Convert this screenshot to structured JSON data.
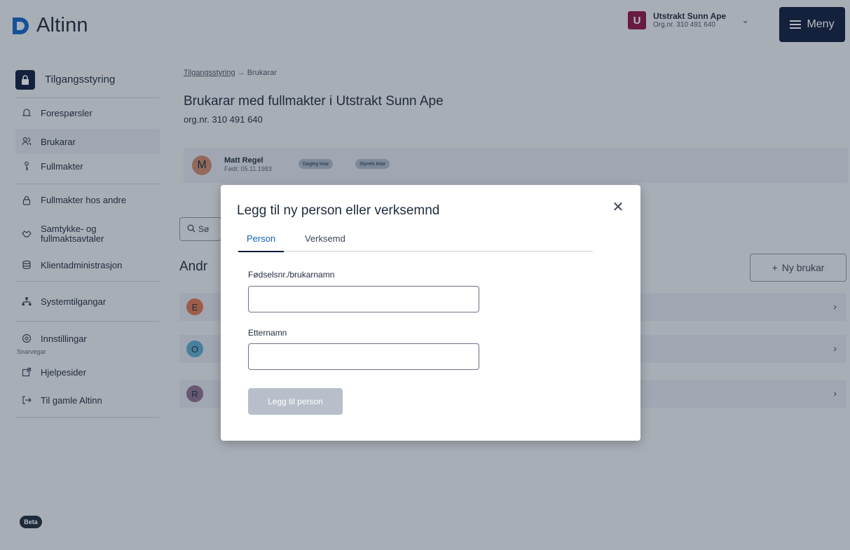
{
  "header": {
    "logo_text": "Altinn",
    "account": {
      "avatar_letter": "U",
      "name": "Utstrakt Sunn Ape",
      "org": "Org.nr. 310 491 640"
    },
    "menu_label": "Meny"
  },
  "sidebar": {
    "title": "Tilgangsstyring",
    "items": [
      {
        "label": "Forespørsler",
        "icon": "bell-icon"
      },
      {
        "label": "Brukarar",
        "icon": "users-icon",
        "active": true
      },
      {
        "label": "Fullmakter",
        "icon": "key-icon"
      },
      {
        "label": "Fullmakter hos andre",
        "icon": "lock-icon"
      },
      {
        "label": "Samtykke- og fullmaktsavtaler",
        "icon": "handshake-icon"
      },
      {
        "label": "Klientadministrasjon",
        "icon": "database-icon"
      },
      {
        "label": "Systemtilgangar",
        "icon": "network-icon"
      },
      {
        "label": "Innstillingar",
        "icon": "gear-icon"
      }
    ],
    "shortcuts_label": "Snarvegar",
    "shortcuts": [
      {
        "label": "Hjelpesider",
        "icon": "external-link-icon"
      },
      {
        "label": "Til gamle Altinn",
        "icon": "enter-icon"
      }
    ],
    "beta_label": "Beta"
  },
  "main": {
    "breadcrumb_link": "Tilgangsstyring",
    "breadcrumb_arrow": "→",
    "breadcrumb_current": "Brukarar",
    "title": "Brukarar med fullmakter i Utstrakt Sunn Ape",
    "org_nr": "org.nr. 310 491 640",
    "owner": {
      "avatar_letter": "M",
      "name": "Matt Regel",
      "dob": "Født: 05.11.1983",
      "tags": [
        "Dagleg leiar",
        "Styrets leiar"
      ]
    },
    "search_placeholder": "Sø",
    "section_title": "Andr",
    "new_user_label": "Ny brukar",
    "users": [
      {
        "avatar_letter": "E",
        "color": "#d9754d"
      },
      {
        "avatar_letter": "O",
        "color": "#5aa9c9"
      },
      {
        "avatar_letter": "R",
        "color": "#8c6d8e"
      }
    ]
  },
  "modal": {
    "title": "Legg til ny person eller verksemnd",
    "tabs": [
      "Person",
      "Verksemd"
    ],
    "active_tab": "Person",
    "field1_label": "Fødselsnr./brukarnamn",
    "field1_value": "",
    "field2_label": "Etternamn",
    "field2_value": "",
    "submit_label": "Legg til person"
  }
}
